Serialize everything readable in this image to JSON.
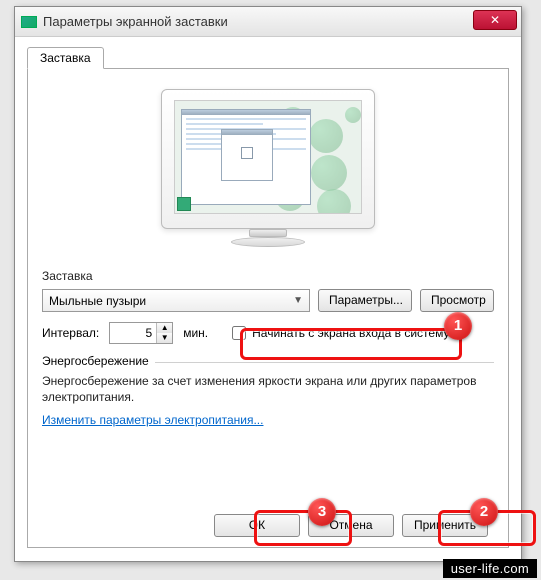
{
  "title": "Параметры экранной заставки",
  "tab": {
    "label": "Заставка"
  },
  "screensaver": {
    "group_label": "Заставка",
    "selected": "Мыльные пузыри",
    "settings_btn": "Параметры...",
    "preview_btn": "Просмотр"
  },
  "interval": {
    "label": "Интервал:",
    "value": "5",
    "unit": "мин.",
    "checkbox_label": "Начинать с экрана входа в систему",
    "checked": false
  },
  "power": {
    "group_label": "Энергосбережение",
    "desc": "Энергосбережение за счет изменения яркости экрана или других параметров электропитания.",
    "link": "Изменить параметры электропитания..."
  },
  "buttons": {
    "ok": "ОК",
    "cancel": "Отмена",
    "apply": "Применить"
  },
  "annotations": {
    "b1": "1",
    "b2": "2",
    "b3": "3"
  },
  "watermark": "user-life.com"
}
